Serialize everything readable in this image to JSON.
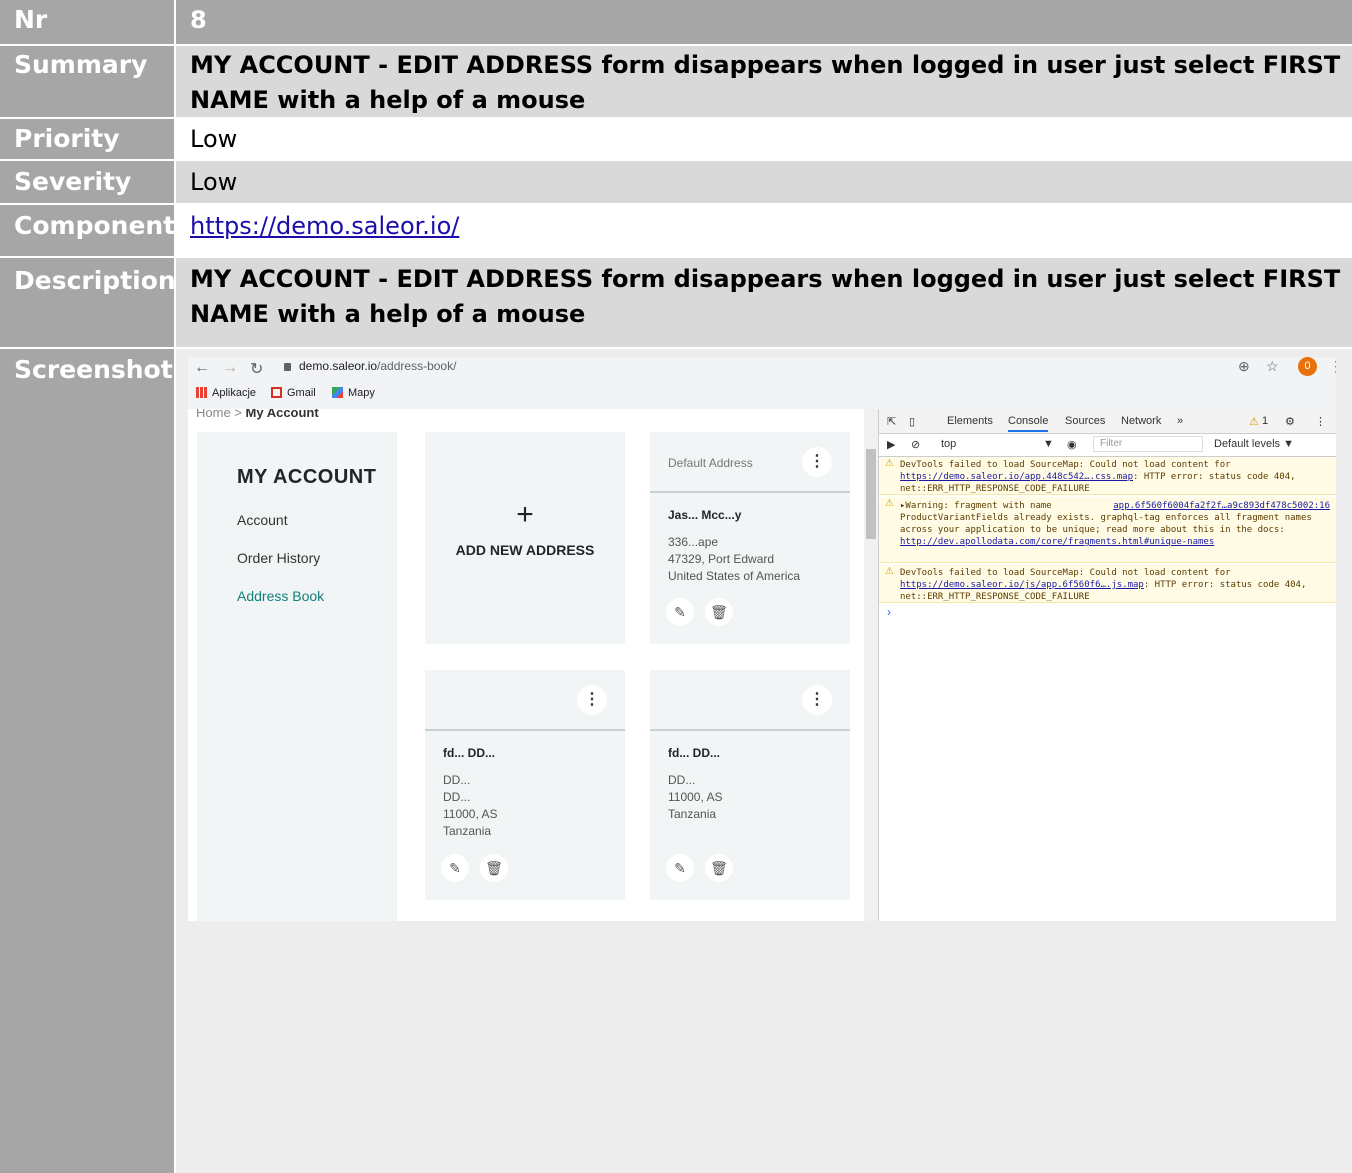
{
  "table": {
    "rows": [
      {
        "label": "Nr",
        "value": "8"
      },
      {
        "label": "Summary",
        "value": "MY ACCOUNT - EDIT ADDRESS form disappears when logged in user just select FIRST NAME with a help of a mouse"
      },
      {
        "label": "Priority",
        "value": "Low"
      },
      {
        "label": "Severity",
        "value": "Low"
      },
      {
        "label": "Component",
        "value": "https://demo.saleor.io/"
      },
      {
        "label": "Description",
        "value": "MY ACCOUNT - EDIT ADDRESS form disappears when logged in user just select FIRST NAME with a help of a mouse"
      },
      {
        "label": "Screenshots",
        "value": ""
      }
    ]
  },
  "screenshot": {
    "browser": {
      "url_host": "demo.saleor.io",
      "url_path": "/address-book/",
      "profile_badge": "0",
      "bookmarks": [
        "Aplikacje",
        "Gmail",
        "Mapy"
      ]
    },
    "site": {
      "breadcrumb_home": "Home",
      "breadcrumb_current": "My Account",
      "sidebar_title": "MY ACCOUNT",
      "sidebar_items": [
        "Account",
        "Order History",
        "Address Book"
      ],
      "add_new": "ADD NEW ADDRESS",
      "default_label": "Default Address",
      "cards": [
        {
          "name": "Jas... Mcc...y",
          "lines": [
            "336...ape",
            "47329, Port Edward",
            "United States of America"
          ]
        },
        {
          "name": "fd... DD...",
          "lines": [
            "DD...",
            "DD...",
            "11000, AS",
            "Tanzania"
          ]
        },
        {
          "name": "fd... DD...",
          "lines": [
            "DD...",
            "11000, AS",
            "Tanzania"
          ]
        }
      ],
      "accent_color": "#13bebb"
    },
    "devtools": {
      "tabs": [
        "Elements",
        "Console",
        "Sources",
        "Network"
      ],
      "warning_count": "1",
      "context": "top",
      "filter_placeholder": "Filter",
      "levels": "Default levels ▼",
      "messages": [
        {
          "text": "DevTools failed to load SourceMap: Could not load content for ",
          "link": "https://demo.saleor.io/app.448c542….css.map",
          "tail": ": HTTP error: status code 404, net::ERR_HTTP_RESPONSE_CODE_FAILURE"
        },
        {
          "text": "▸Warning: fragment with name ProductVariantFields already exists. graphql-tag enforces all fragment names across your application to be unique; read more about this in the docs: ",
          "link": "http://dev.apollodata.com/core/fragments.html#unique-names",
          "source": "app.6f560f6004fa2f2f…a9c893df478c5002:16"
        },
        {
          "text": "DevTools failed to load SourceMap: Could not load content for ",
          "link": "https://demo.saleor.io/js/app.6f560f6….js.map",
          "tail": ": HTTP error: status code 404, net::ERR_HTTP_RESPONSE_CODE_FAILURE"
        }
      ]
    }
  }
}
